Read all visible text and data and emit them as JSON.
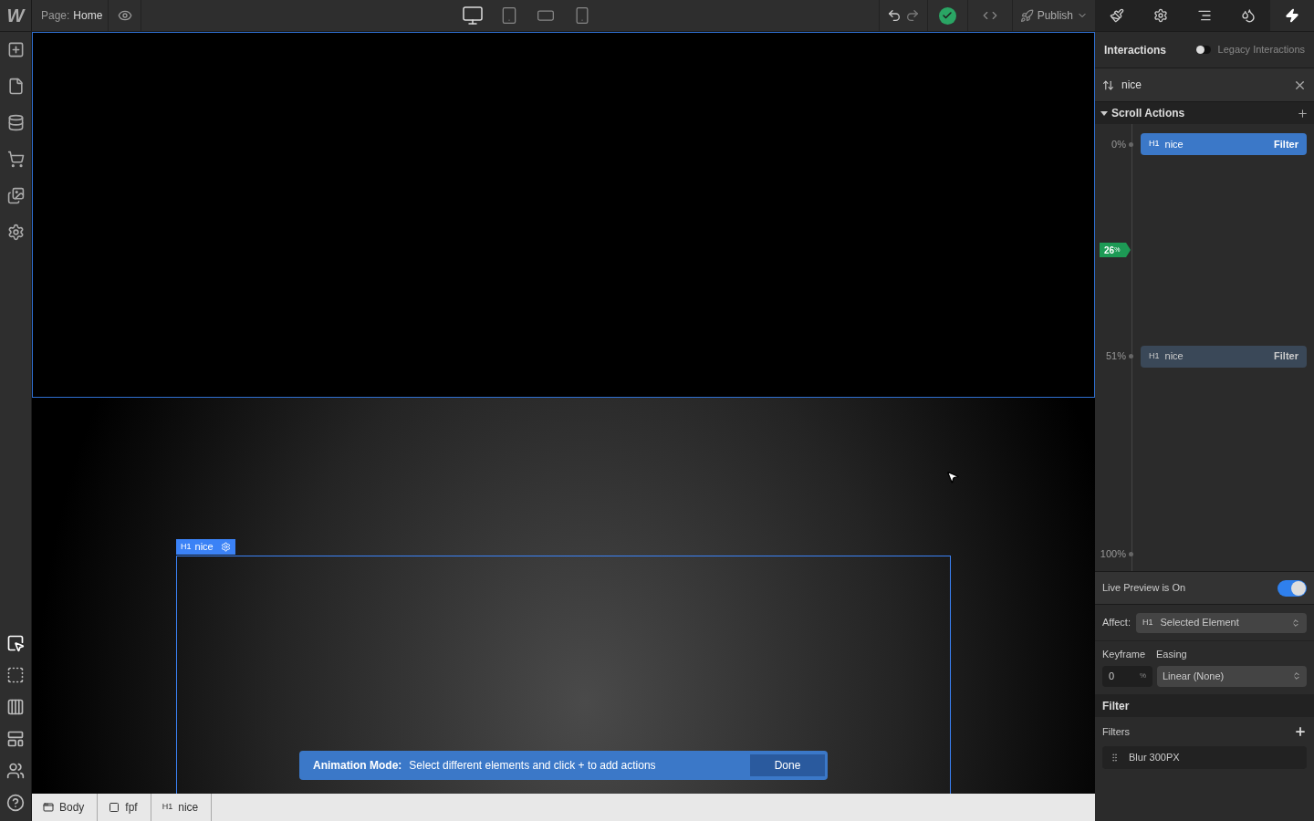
{
  "topbar": {
    "logo": "W",
    "page_label": "Page:",
    "page_name": "Home",
    "devices": [
      {
        "kind": "desktop",
        "selected": true
      },
      {
        "kind": "tablet",
        "selected": false
      },
      {
        "kind": "landscape",
        "selected": false
      },
      {
        "kind": "phone",
        "selected": false
      }
    ],
    "publish": "Publish"
  },
  "panel_tabs": [
    {
      "kind": "style",
      "selected": false
    },
    {
      "kind": "settings",
      "selected": false
    },
    {
      "kind": "navigator",
      "selected": false
    },
    {
      "kind": "assets",
      "selected": false
    },
    {
      "kind": "interactions",
      "selected": true
    }
  ],
  "interactions": {
    "title": "Interactions",
    "legacy": {
      "label": "Legacy Interactions",
      "on": false
    },
    "trigger": {
      "name": "nice"
    },
    "scroll_actions": {
      "title": "Scroll Actions",
      "expanded": true,
      "keyframes": [
        {
          "percent": "0%",
          "tag": "H1",
          "name": "nice",
          "action": "Filter",
          "selected": true
        },
        {
          "percent": "51%",
          "tag": "H1",
          "name": "nice",
          "action": "Filter",
          "selected": false
        },
        {
          "percent": "100%"
        }
      ],
      "marker": {
        "value": "26",
        "unit": "%"
      }
    },
    "live_preview": {
      "label": "Live Preview is On",
      "on": true
    },
    "affect": {
      "label": "Affect:",
      "tag": "H1",
      "value": "Selected Element"
    },
    "keyframe": {
      "label": "Keyframe",
      "value": "0",
      "unit": "%"
    },
    "easing": {
      "label": "Easing",
      "value": "Linear (None)"
    },
    "filter_section": {
      "title": "Filter",
      "filters_label": "Filters",
      "items": [
        {
          "name": "Blur 300PX"
        }
      ]
    }
  },
  "canvas": {
    "selected_element": {
      "tag": "H1",
      "name": "nice"
    },
    "banner": {
      "title": "Animation Mode:",
      "message": "Select different elements and click + to add actions",
      "button": "Done"
    }
  },
  "breadcrumbs": [
    {
      "kind": "body",
      "label": "Body"
    },
    {
      "kind": "div",
      "label": "fpf"
    },
    {
      "kind": "heading",
      "tag": "H1",
      "label": "nice"
    }
  ]
}
